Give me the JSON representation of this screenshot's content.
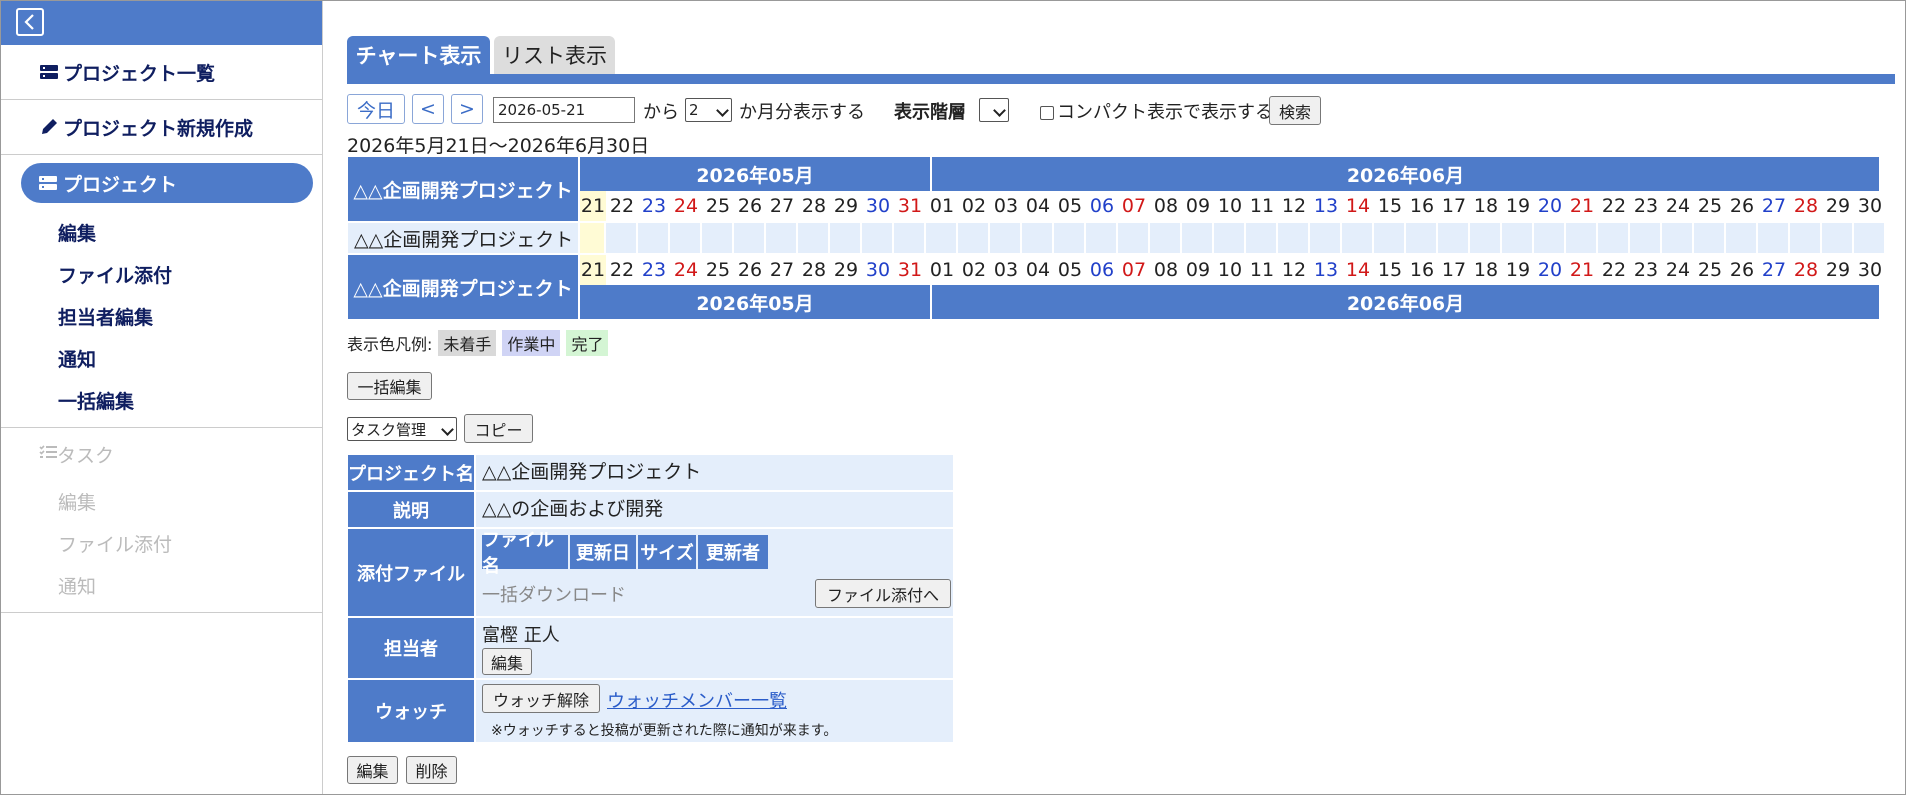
{
  "sidebar": {
    "back_label": "",
    "project_list": "プロジェクト一覧",
    "new_project": "プロジェクト新規作成",
    "project": "プロジェクト",
    "project_items": [
      "編集",
      "ファイル添付",
      "担当者編集",
      "通知",
      "一括編集"
    ],
    "task": "タスク",
    "task_items": [
      "編集",
      "ファイル添付",
      "通知"
    ]
  },
  "tabs": {
    "chart": "チャート表示",
    "list": "リスト表示"
  },
  "toolbar": {
    "today": "今日",
    "prev": "<",
    "next": ">",
    "date_value": "2026-05-21",
    "from": "から",
    "months_value": "2",
    "months_suffix": "か月分表示する",
    "level_label": "表示階層",
    "compact_label": "コンパクト表示で表示する",
    "search": "検索"
  },
  "range_text": "2026年5月21日～2026年6月30日",
  "gantt": {
    "month1": "2026年05月",
    "month2": "2026年06月",
    "header_label": "△△企画開発プロジェクト",
    "row_label": "△△企画開発プロジェクト",
    "footer_label": "△△企画開発プロジェクト",
    "days": [
      "21",
      "22",
      "23",
      "24",
      "25",
      "26",
      "27",
      "28",
      "29",
      "30",
      "31",
      "01",
      "02",
      "03",
      "04",
      "05",
      "06",
      "07",
      "08",
      "09",
      "10",
      "11",
      "12",
      "13",
      "14",
      "15",
      "16",
      "17",
      "18",
      "19",
      "20",
      "21",
      "22",
      "23",
      "24",
      "25",
      "26",
      "27",
      "28",
      "29",
      "30"
    ],
    "day_types": [
      "today",
      "",
      "blue",
      "red",
      "",
      "",
      "",
      "",
      "",
      "blue",
      "red",
      "",
      "",
      "",
      "",
      "",
      "blue",
      "red",
      "",
      "",
      "",
      "",
      "",
      "blue",
      "red",
      "",
      "",
      "",
      "",
      "",
      "blue",
      "red",
      "",
      "",
      "",
      "",
      "",
      "blue",
      "red",
      "",
      ""
    ]
  },
  "legend": {
    "label": "表示色凡例:",
    "not_started": "未着手",
    "in_progress": "作業中",
    "done": "完了",
    "not_started_color": "#d9d9d9",
    "in_progress_color": "#d0d4f5",
    "done_color": "#d4f5d4"
  },
  "bulk_edit": "一括編集",
  "task_select": "タスク管理",
  "copy": "コピー",
  "detail": {
    "project_name_label": "プロジェクト名",
    "project_name": "△△企画開発プロジェクト",
    "description_label": "説明",
    "description": "△△の企画および開発",
    "attachments_label": "添付ファイル",
    "file_cols": [
      "ファイル名",
      "更新日",
      "サイズ",
      "更新者"
    ],
    "bulk_download": "一括ダウンロード",
    "to_attach": "ファイル添付へ",
    "assignee_label": "担当者",
    "assignee": "富樫 正人",
    "assignee_edit": "編集",
    "watch_label": "ウォッチ",
    "unwatch": "ウォッチ解除",
    "watch_members": "ウォッチメンバー一覧",
    "watch_note": "※ウォッチすると投稿が更新された際に通知が来ます。"
  },
  "footer_buttons": {
    "edit": "編集",
    "delete": "削除"
  },
  "colors": {
    "accent": "#4e7bc9",
    "cell_bg": "#e4eefb",
    "today_bg": "#fffbd5",
    "weekday_blue": "#2140c9",
    "weekend_red": "#d11818"
  }
}
